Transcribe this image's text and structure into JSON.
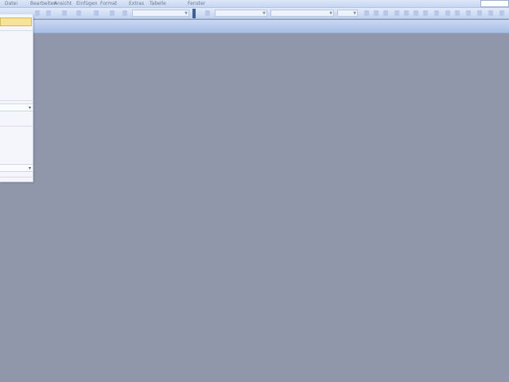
{
  "menubar": {
    "items": [
      "Datei",
      "Bearbeiten",
      "Ansicht",
      "Einfügen",
      "Format",
      "Extras",
      "Tabelle",
      "Fenster",
      "?"
    ]
  },
  "taskpane": {
    "highlight_label": "",
    "labels": [
      "",
      "",
      "",
      ""
    ]
  },
  "colors": {
    "workspace": "#9197ab",
    "toolbar": "#c6d6f1",
    "highlight": "#f7e29a"
  }
}
